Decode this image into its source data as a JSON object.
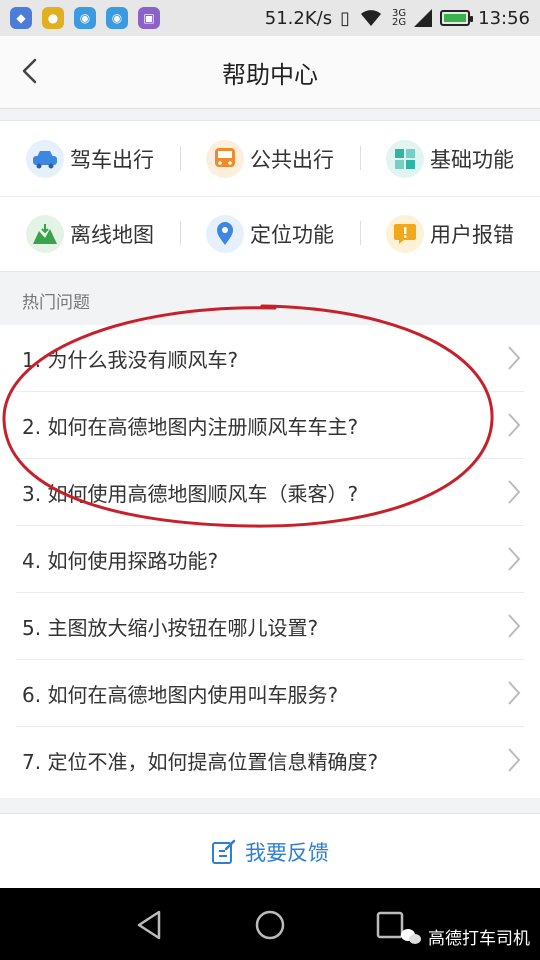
{
  "status": {
    "speed": "51.2K/s",
    "net_top": "3G",
    "net_bottom": "2G",
    "time": "13:56"
  },
  "header": {
    "title": "帮助中心"
  },
  "categories": [
    {
      "label": "驾车出行",
      "icon": "car-icon",
      "color": "#3d87e0"
    },
    {
      "label": "公共出行",
      "icon": "bus-icon",
      "color": "#f08a2a"
    },
    {
      "label": "基础功能",
      "icon": "grid-icon",
      "color": "#2fb5a4"
    },
    {
      "label": "离线地图",
      "icon": "offline-map-icon",
      "color": "#3aa34a"
    },
    {
      "label": "定位功能",
      "icon": "location-pin-icon",
      "color": "#3d87e0"
    },
    {
      "label": "用户报错",
      "icon": "warning-icon",
      "color": "#f2a81b"
    }
  ],
  "hot": {
    "title": "热门问题",
    "items": [
      "1. 为什么我没有顺风车?",
      "2. 如何在高德地图内注册顺风车车主?",
      "3. 如何使用高德地图顺风车（乘客）?",
      "4. 如何使用探路功能?",
      "5. 主图放大缩小按钮在哪儿设置?",
      "6. 如何在高德地图内使用叫车服务?",
      "7. 定位不准，如何提高位置信息精确度?"
    ]
  },
  "feedback": {
    "label": "我要反馈"
  },
  "watermark": {
    "text": "高德打车司机"
  },
  "colors": {
    "accent": "#2b7fd6",
    "annotation": "#c8202a"
  }
}
